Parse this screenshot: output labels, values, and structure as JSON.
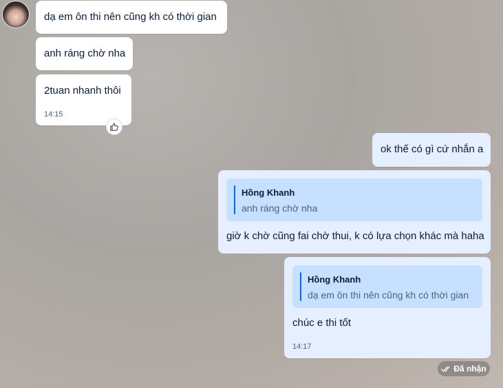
{
  "messages": {
    "m1": {
      "text": "dạ em ôn thi nên cũng kh có thời gian"
    },
    "m2": {
      "text": "anh ráng chờ nha"
    },
    "m3": {
      "text": "2tuan nhanh thôi",
      "time": "14:15"
    },
    "m4": {
      "text": "ok thế có gì cứ nhắn a"
    },
    "m5": {
      "quote_sender": "Hồng Khanh",
      "quote_text": "anh ráng chờ nha",
      "text": "giờ k chờ cũng fai chờ thui, k có lựa chọn khác mà haha"
    },
    "m6": {
      "quote_sender": "Hồng Khanh",
      "quote_text": "dạ em ôn thi nên cũng kh có thời gian",
      "text": "chúc e thi tốt",
      "time": "14:17"
    }
  },
  "status": {
    "label": "Đã nhận"
  },
  "icons": {
    "react": "thumbs-up-icon",
    "status": "double-check-icon",
    "avatar": "contact-avatar"
  },
  "colors": {
    "incoming_bubble": "#ffffff",
    "outgoing_bubble": "#e5efff",
    "quote_bg": "#c7e0ff",
    "quote_bar": "#0068ff"
  }
}
